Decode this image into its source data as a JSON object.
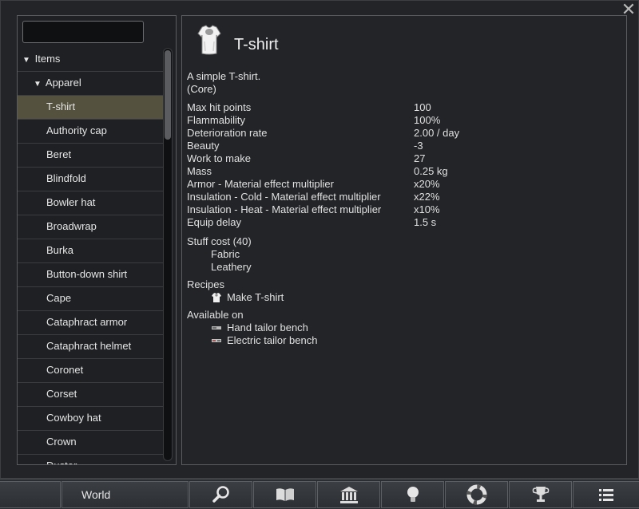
{
  "window": {
    "close_glyph": "✕"
  },
  "search": {
    "value": "",
    "placeholder": ""
  },
  "tree": {
    "root": {
      "label": "Items",
      "expanded": true
    },
    "category": {
      "label": "Apparel",
      "expanded": true
    },
    "items": [
      "T-shirt",
      "Authority cap",
      "Beret",
      "Blindfold",
      "Bowler hat",
      "Broadwrap",
      "Burka",
      "Button-down shirt",
      "Cape",
      "Cataphract armor",
      "Cataphract helmet",
      "Coronet",
      "Corset",
      "Cowboy hat",
      "Crown",
      "Duster"
    ],
    "selected_index": 0
  },
  "detail": {
    "title": "T-shirt",
    "icon": "tshirt-icon",
    "description": "A simple T-shirt.",
    "source": "(Core)",
    "stats": [
      {
        "label": "Max hit points",
        "value": "100"
      },
      {
        "label": "Flammability",
        "value": "100%"
      },
      {
        "label": "Deterioration rate",
        "value": "2.00 / day"
      },
      {
        "label": "Beauty",
        "value": "-3"
      },
      {
        "label": "Work to make",
        "value": "27"
      },
      {
        "label": "Mass",
        "value": "0.25 kg"
      },
      {
        "label": "Armor - Material effect multiplier",
        "value": "x20%"
      },
      {
        "label": "Insulation - Cold - Material effect multiplier",
        "value": "x22%"
      },
      {
        "label": "Insulation - Heat - Material effect multiplier",
        "value": "x10%"
      },
      {
        "label": "Equip delay",
        "value": "1.5 s"
      }
    ],
    "stuff_cost": {
      "heading": "Stuff cost (40)",
      "items": [
        "Fabric",
        "Leathery"
      ]
    },
    "recipes": {
      "heading": "Recipes",
      "items": [
        {
          "label": "Make T-shirt",
          "icon": "tshirt-icon"
        }
      ]
    },
    "available_on": {
      "heading": "Available on",
      "items": [
        {
          "label": "Hand tailor bench",
          "icon": "hand-tailor-bench-icon"
        },
        {
          "label": "Electric tailor bench",
          "icon": "electric-tailor-bench-icon"
        }
      ]
    }
  },
  "bottombar": {
    "world_label": "World",
    "buttons": [
      "search-icon",
      "book-icon",
      "factions-icon",
      "lightbulb-icon",
      "lifebuoy-icon",
      "trophy-icon",
      "menu-list-icon"
    ]
  }
}
